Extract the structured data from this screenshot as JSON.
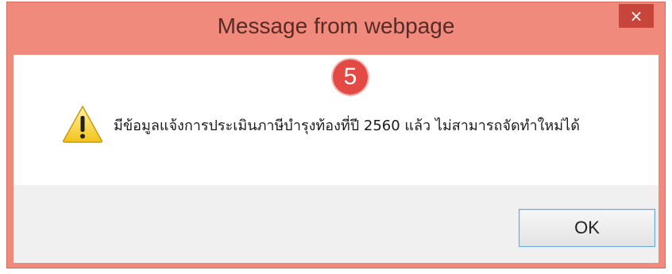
{
  "window": {
    "title": "Message from webpage",
    "close_glyph": "×"
  },
  "annotation": {
    "step_number": "5",
    "color": "#e34a45"
  },
  "message": {
    "icon": "warning-icon",
    "text": "มีข้อมูลแจ้งการประเมินภาษีบำรุงท้องที่ปี 2560 แล้ว ไม่สามารถจัดทำใหม่ได้"
  },
  "buttons": {
    "ok_label": "OK"
  },
  "colors": {
    "title_bar": "#f08a7c",
    "close_button": "#c7453a",
    "footer": "#f0f0f0",
    "ok_border": "#6aa7de"
  }
}
